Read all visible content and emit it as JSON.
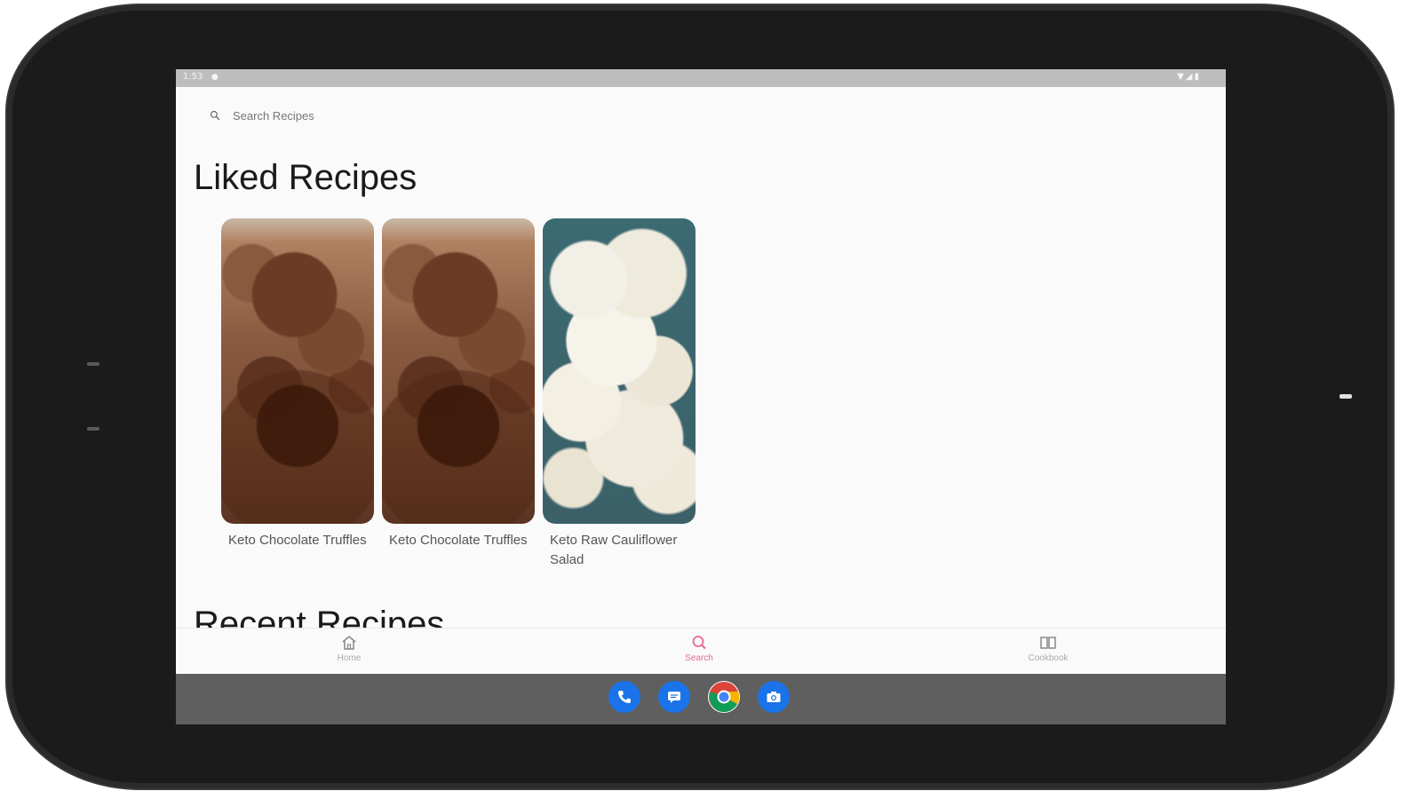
{
  "statusbar": {
    "time": "1:53",
    "sync_icon": "sync-icon",
    "right_icons": "wifi-icon signal-icon battery-icon"
  },
  "search": {
    "placeholder": "Search Recipes",
    "icon": "search-icon"
  },
  "liked": {
    "heading": "Liked Recipes",
    "recipes": [
      {
        "title": "Keto Chocolate Truffles",
        "image": "truffle"
      },
      {
        "title": "Keto Chocolate Truffles",
        "image": "truffle"
      },
      {
        "title": "Keto Raw Cauliflower Salad",
        "image": "salad"
      }
    ]
  },
  "recent": {
    "heading": "Recent Recipes"
  },
  "bottom_nav": {
    "items": [
      {
        "label": "Home",
        "icon": "home-icon",
        "active": false
      },
      {
        "label": "Search",
        "icon": "search-icon",
        "active": true
      },
      {
        "label": "Cookbook",
        "icon": "book-icon",
        "active": false
      }
    ]
  },
  "dock": {
    "apps": [
      "phone-icon",
      "messages-icon",
      "chrome-icon",
      "camera-icon"
    ]
  },
  "colors": {
    "accent": "#e36b93",
    "status_bar": "#bdbdbd",
    "nav_bar": "#5f5f5f",
    "device_frame": "#1b1b1b"
  }
}
